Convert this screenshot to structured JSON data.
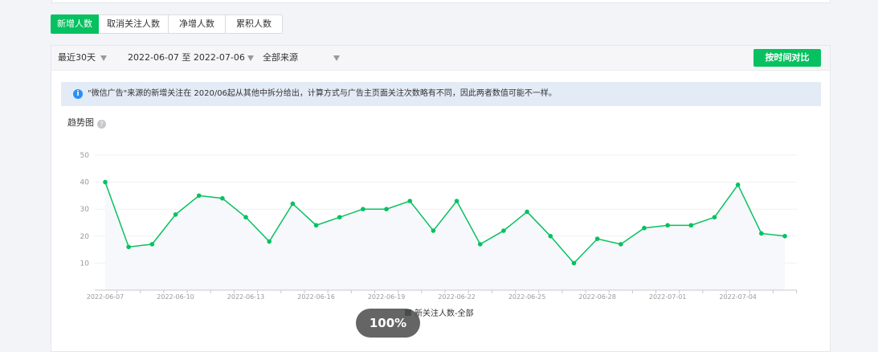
{
  "tabs": [
    {
      "label": "新增人数",
      "active": true
    },
    {
      "label": "取消关注人数",
      "active": false
    },
    {
      "label": "净增人数",
      "active": false
    },
    {
      "label": "累积人数",
      "active": false
    }
  ],
  "toolbar": {
    "period": "最近30天",
    "date_range": "2022-06-07 至 2022-07-06",
    "source": "全部来源",
    "compare_button": "按时间对比"
  },
  "notice": {
    "icon": "info-icon",
    "text": "\"微信广告\"来源的新增关注在 2020/06起从其他中拆分给出，计算方式与广告主页面关注次数略有不同，因此两者数值可能不一样。"
  },
  "trend": {
    "title": "趋势图",
    "help_icon": "question-icon"
  },
  "chart_data": {
    "type": "line",
    "x": [
      "2022-06-07",
      "2022-06-08",
      "2022-06-09",
      "2022-06-10",
      "2022-06-11",
      "2022-06-12",
      "2022-06-13",
      "2022-06-14",
      "2022-06-15",
      "2022-06-16",
      "2022-06-17",
      "2022-06-18",
      "2022-06-19",
      "2022-06-20",
      "2022-06-21",
      "2022-06-22",
      "2022-06-23",
      "2022-06-24",
      "2022-06-25",
      "2022-06-26",
      "2022-06-27",
      "2022-06-28",
      "2022-06-29",
      "2022-06-30",
      "2022-07-01",
      "2022-07-02",
      "2022-07-03",
      "2022-07-04",
      "2022-07-05",
      "2022-07-06"
    ],
    "x_tick_labels": [
      "2022-06-07",
      "2022-06-10",
      "2022-06-13",
      "2022-06-16",
      "2022-06-19",
      "2022-06-22",
      "2022-06-25",
      "2022-06-28",
      "2022-07-01",
      "2022-07-04"
    ],
    "y_ticks": [
      10,
      20,
      30,
      40,
      50
    ],
    "ylim": [
      0,
      50
    ],
    "series": [
      {
        "name": "新关注人数-全部",
        "color": "#07c160",
        "values": [
          40,
          16,
          17,
          28,
          35,
          34,
          27,
          18,
          32,
          24,
          27,
          30,
          30,
          33,
          22,
          33,
          17,
          22,
          29,
          20,
          10,
          19,
          17,
          23,
          24,
          24,
          27,
          39,
          21,
          20
        ]
      }
    ],
    "legend_position": "bottom",
    "grid": true
  },
  "zoom": {
    "label": "100%"
  }
}
